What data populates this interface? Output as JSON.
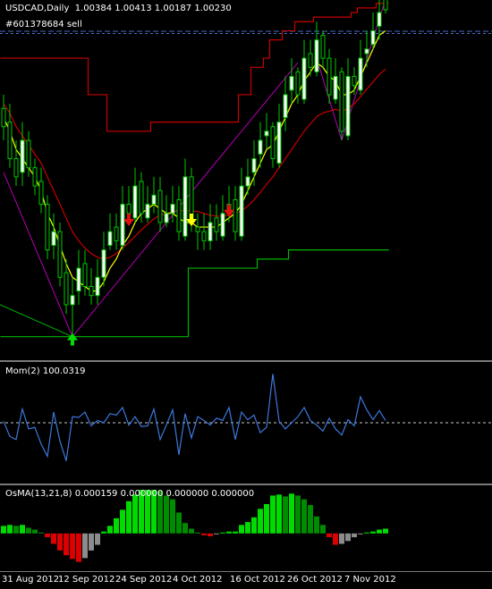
{
  "header": {
    "title": "USDCAD,Daily  1.00384 1.00413 1.00187 1.00230",
    "order": "#601378684 sell"
  },
  "colors": {
    "background": "#000000",
    "bull_candle": "#ffffff",
    "bear_candle": "#000000",
    "ma_fast": "#ffff00",
    "ma_slow": "#c80000",
    "channel_upper": "#c80000",
    "channel_lower": "#00b400",
    "fan_lines": "#b400b4",
    "momentum_line": "#3c78dc",
    "osma_up_strong": "#00dc00",
    "osma_up_weak": "#008c00",
    "osma_down": "#dc0000",
    "osma_flat": "#8c8c8c"
  },
  "x_axis": {
    "labels": [
      "31 Aug 2012",
      "12 Sep 2012",
      "24 Sep 2012",
      "4 Oct 2012",
      "16 Oct 2012",
      "26 Oct 2012",
      "7 Nov 2012"
    ]
  },
  "chart_data": [
    {
      "type": "candlestick",
      "title": "USDCAD,Daily",
      "ohlc_header": [
        1.00384,
        1.00413,
        1.00187,
        1.0023
      ],
      "ylim": [
        0.965,
        1.002
      ],
      "series": [
        {
          "name": "close",
          "values": [
            0.9895,
            0.986,
            0.984,
            0.988,
            0.985,
            0.983,
            0.981,
            0.976,
            0.978,
            0.973,
            0.97,
            0.971,
            0.974,
            0.972,
            0.971,
            0.973,
            0.976,
            0.978,
            0.977,
            0.981,
            0.98,
            0.983,
            0.98,
            0.981,
            0.982,
            0.979,
            0.98,
            0.981,
            0.978,
            0.984,
            0.979,
            0.978,
            0.977,
            0.979,
            0.978,
            0.98,
            0.981,
            0.978,
            0.983,
            0.984,
            0.986,
            0.988,
            0.989,
            0.986,
            0.99,
            0.993,
            0.995,
            0.993,
            0.997,
            0.996,
            0.999,
            0.997,
            0.993,
            0.995,
            0.989,
            0.995,
            0.994,
            0.997,
            0.998,
            1.0,
            1.002,
            1.0023
          ]
        },
        {
          "name": "open",
          "values": [
            0.9915,
            0.99,
            0.986,
            0.9845,
            0.988,
            0.985,
            0.9835,
            0.981,
            0.9765,
            0.978,
            0.9735,
            0.97,
            0.9715,
            0.9745,
            0.972,
            0.971,
            0.973,
            0.9765,
            0.9785,
            0.9765,
            0.981,
            0.9795,
            0.9835,
            0.9795,
            0.981,
            0.9825,
            0.979,
            0.98,
            0.9815,
            0.9775,
            0.984,
            0.9785,
            0.978,
            0.977,
            0.9795,
            0.9775,
            0.98,
            0.9815,
            0.9775,
            0.983,
            0.9845,
            0.9865,
            0.9885,
            0.9895,
            0.9855,
            0.9905,
            0.9935,
            0.9955,
            0.9925,
            0.9975,
            0.9955,
            0.9995,
            0.997,
            0.9925,
            0.9955,
            0.9885,
            0.995,
            0.9935,
            0.9975,
            0.9985,
            1.0005,
            1.0038
          ]
        },
        {
          "name": "high",
          "values": [
            0.993,
            0.992,
            0.988,
            0.99,
            0.989,
            0.986,
            0.985,
            0.982,
            0.98,
            0.979,
            0.975,
            0.973,
            0.976,
            0.976,
            0.974,
            0.975,
            0.978,
            0.98,
            0.98,
            0.983,
            0.983,
            0.985,
            0.9845,
            0.983,
            0.984,
            0.984,
            0.982,
            0.983,
            0.983,
            0.986,
            0.985,
            0.98,
            0.98,
            0.981,
            0.981,
            0.982,
            0.983,
            0.983,
            0.985,
            0.986,
            0.988,
            0.99,
            0.991,
            0.99,
            0.992,
            0.995,
            0.997,
            0.996,
            0.999,
            0.999,
            1.001,
            1.0,
            0.998,
            0.997,
            0.996,
            0.997,
            0.996,
            0.999,
            1.0,
            1.002,
            1.0035,
            1.0041
          ]
        },
        {
          "name": "low",
          "values": [
            0.988,
            0.985,
            0.983,
            0.983,
            0.984,
            0.982,
            0.98,
            0.975,
            0.975,
            0.972,
            0.969,
            0.9665,
            0.97,
            0.971,
            0.97,
            0.97,
            0.972,
            0.976,
            0.976,
            0.976,
            0.979,
            0.979,
            0.979,
            0.979,
            0.98,
            0.978,
            0.9785,
            0.979,
            0.977,
            0.977,
            0.978,
            0.976,
            0.976,
            0.976,
            0.977,
            0.977,
            0.979,
            0.977,
            0.977,
            0.982,
            0.983,
            0.985,
            0.987,
            0.985,
            0.985,
            0.989,
            0.992,
            0.992,
            0.992,
            0.995,
            0.995,
            0.996,
            0.992,
            0.992,
            0.988,
            0.988,
            0.993,
            0.993,
            0.996,
            0.998,
            0.999,
            1.0019
          ]
        },
        {
          "name": "upper",
          "values": [
            0.997,
            0.997,
            0.997,
            0.997,
            0.997,
            0.997,
            0.997,
            0.997,
            0.997,
            0.997,
            0.997,
            0.997,
            0.997,
            0.997,
            0.993,
            0.993,
            0.993,
            0.989,
            0.989,
            0.989,
            0.989,
            0.989,
            0.989,
            0.989,
            0.99,
            0.99,
            0.99,
            0.99,
            0.99,
            0.99,
            0.99,
            0.99,
            0.99,
            0.99,
            0.99,
            0.99,
            0.99,
            0.99,
            0.993,
            0.993,
            0.996,
            0.996,
            0.997,
            0.999,
            0.999,
            1.0,
            1.0,
            1.001,
            1.001,
            1.001,
            1.0015,
            1.0015,
            1.0015,
            1.0015,
            1.0015,
            1.0015,
            1.002,
            1.0025,
            1.0025,
            1.0025,
            1.003,
            1.003
          ]
        },
        {
          "name": "lower",
          "values": [
            0.9665,
            0.9665,
            0.9665,
            0.9665,
            0.9665,
            0.9665,
            0.9665,
            0.9665,
            0.9665,
            0.9665,
            0.9665,
            0.9665,
            0.9665,
            0.9665,
            0.9665,
            0.9665,
            0.9665,
            0.9665,
            0.9665,
            0.9665,
            0.9665,
            0.9665,
            0.9665,
            0.9665,
            0.9665,
            0.9665,
            0.9665,
            0.9665,
            0.9665,
            0.9665,
            0.974,
            0.974,
            0.974,
            0.974,
            0.974,
            0.974,
            0.974,
            0.974,
            0.974,
            0.974,
            0.974,
            0.975,
            0.975,
            0.975,
            0.975,
            0.975,
            0.976,
            0.976,
            0.976,
            0.976,
            0.976,
            0.976,
            0.976,
            0.976,
            0.976,
            0.976,
            0.976,
            0.976,
            0.976,
            0.976,
            0.976,
            0.976
          ]
        },
        {
          "name": "ma_fast",
          "values": [
            0.9905,
            0.989,
            0.987,
            0.986,
            0.985,
            0.984,
            0.9825,
            0.98,
            0.9785,
            0.9765,
            0.9745,
            0.973,
            0.9725,
            0.972,
            0.9715,
            0.9715,
            0.9725,
            0.974,
            0.975,
            0.9765,
            0.9775,
            0.979,
            0.98,
            0.9805,
            0.981,
            0.9805,
            0.98,
            0.98,
            0.9795,
            0.979,
            0.979,
            0.9785,
            0.9785,
            0.9785,
            0.9785,
            0.979,
            0.9795,
            0.98,
            0.981,
            0.9825,
            0.984,
            0.9855,
            0.987,
            0.9875,
            0.989,
            0.9905,
            0.992,
            0.993,
            0.9945,
            0.9955,
            0.9965,
            0.996,
            0.995,
            0.9945,
            0.993,
            0.993,
            0.9935,
            0.995,
            0.9965,
            0.998,
            0.9995,
            1.0
          ]
        },
        {
          "name": "ma_slow",
          "values": [
            0.992,
            0.991,
            0.9895,
            0.9885,
            0.9875,
            0.9865,
            0.9855,
            0.984,
            0.9825,
            0.981,
            0.9795,
            0.978,
            0.977,
            0.9762,
            0.9756,
            0.9752,
            0.975,
            0.9752,
            0.9756,
            0.9762,
            0.9768,
            0.9775,
            0.9782,
            0.9788,
            0.9794,
            0.9798,
            0.98,
            0.9802,
            0.9803,
            0.9803,
            0.9803,
            0.9802,
            0.98,
            0.9798,
            0.9797,
            0.9797,
            0.9798,
            0.98,
            0.9803,
            0.9808,
            0.9815,
            0.9823,
            0.9832,
            0.984,
            0.985,
            0.986,
            0.987,
            0.988,
            0.989,
            0.9898,
            0.9906,
            0.991,
            0.9912,
            0.9914,
            0.9912,
            0.9915,
            0.992,
            0.9928,
            0.9936,
            0.9944,
            0.9952,
            0.9958
          ]
        }
      ]
    },
    {
      "type": "line",
      "title": "Mom(2) 100.0319",
      "ylim": [
        99.25,
        100.75
      ],
      "series": [
        {
          "name": "Mom(2)",
          "values": [
            100.02,
            99.82,
            99.78,
            100.18,
            99.92,
            99.94,
            99.72,
            99.56,
            100.14,
            99.76,
            99.5,
            100.08,
            100.07,
            100.14,
            99.96,
            100.03,
            100.0,
            100.12,
            100.1,
            100.2,
            99.97,
            100.08,
            99.95,
            99.96,
            100.18,
            99.78,
            99.97,
            100.17,
            99.58,
            100.12,
            99.8,
            100.08,
            100.03,
            99.97,
            100.06,
            100.03,
            100.2,
            99.78,
            100.14,
            100.04,
            100.1,
            99.87,
            99.94,
            100.64,
            100.02,
            99.92,
            100.0,
            100.08,
            100.2,
            100.03,
            99.97,
            99.89,
            100.06,
            99.92,
            99.84,
            100.04,
            99.96,
            100.34,
            100.17,
            100.04,
            100.16,
            100.03
          ]
        }
      ]
    },
    {
      "type": "bar",
      "title": "OsMA(13,21,8) 0.000159 0.000000 0.000000 0.000000",
      "ylim": [
        -0.0036,
        0.0047
      ],
      "series": [
        {
          "name": "OsMA",
          "values": [
            0.0008,
            0.0009,
            0.0008,
            0.0009,
            0.0006,
            0.0004,
            0.0001,
            -0.0004,
            -0.0011,
            -0.0018,
            -0.0023,
            -0.0027,
            -0.003,
            -0.0026,
            -0.0018,
            -0.0012,
            0.0002,
            0.0008,
            0.0016,
            0.0025,
            0.0034,
            0.0041,
            0.0046,
            0.0046,
            0.0046,
            0.0045,
            0.004,
            0.0036,
            0.0022,
            0.0011,
            0.0005,
            0.0001,
            -0.0002,
            -0.0003,
            -0.0001,
            0.0001,
            0.0002,
            0.0002,
            0.0009,
            0.0012,
            0.0017,
            0.0026,
            0.0031,
            0.004,
            0.0041,
            0.0039,
            0.0042,
            0.004,
            0.0036,
            0.003,
            0.0018,
            0.0009,
            -0.0004,
            -0.0012,
            -0.0011,
            -0.0008,
            -0.0004,
            -0.0001,
            0.0001,
            0.0002,
            0.0004,
            0.0005
          ]
        }
      ]
    }
  ]
}
